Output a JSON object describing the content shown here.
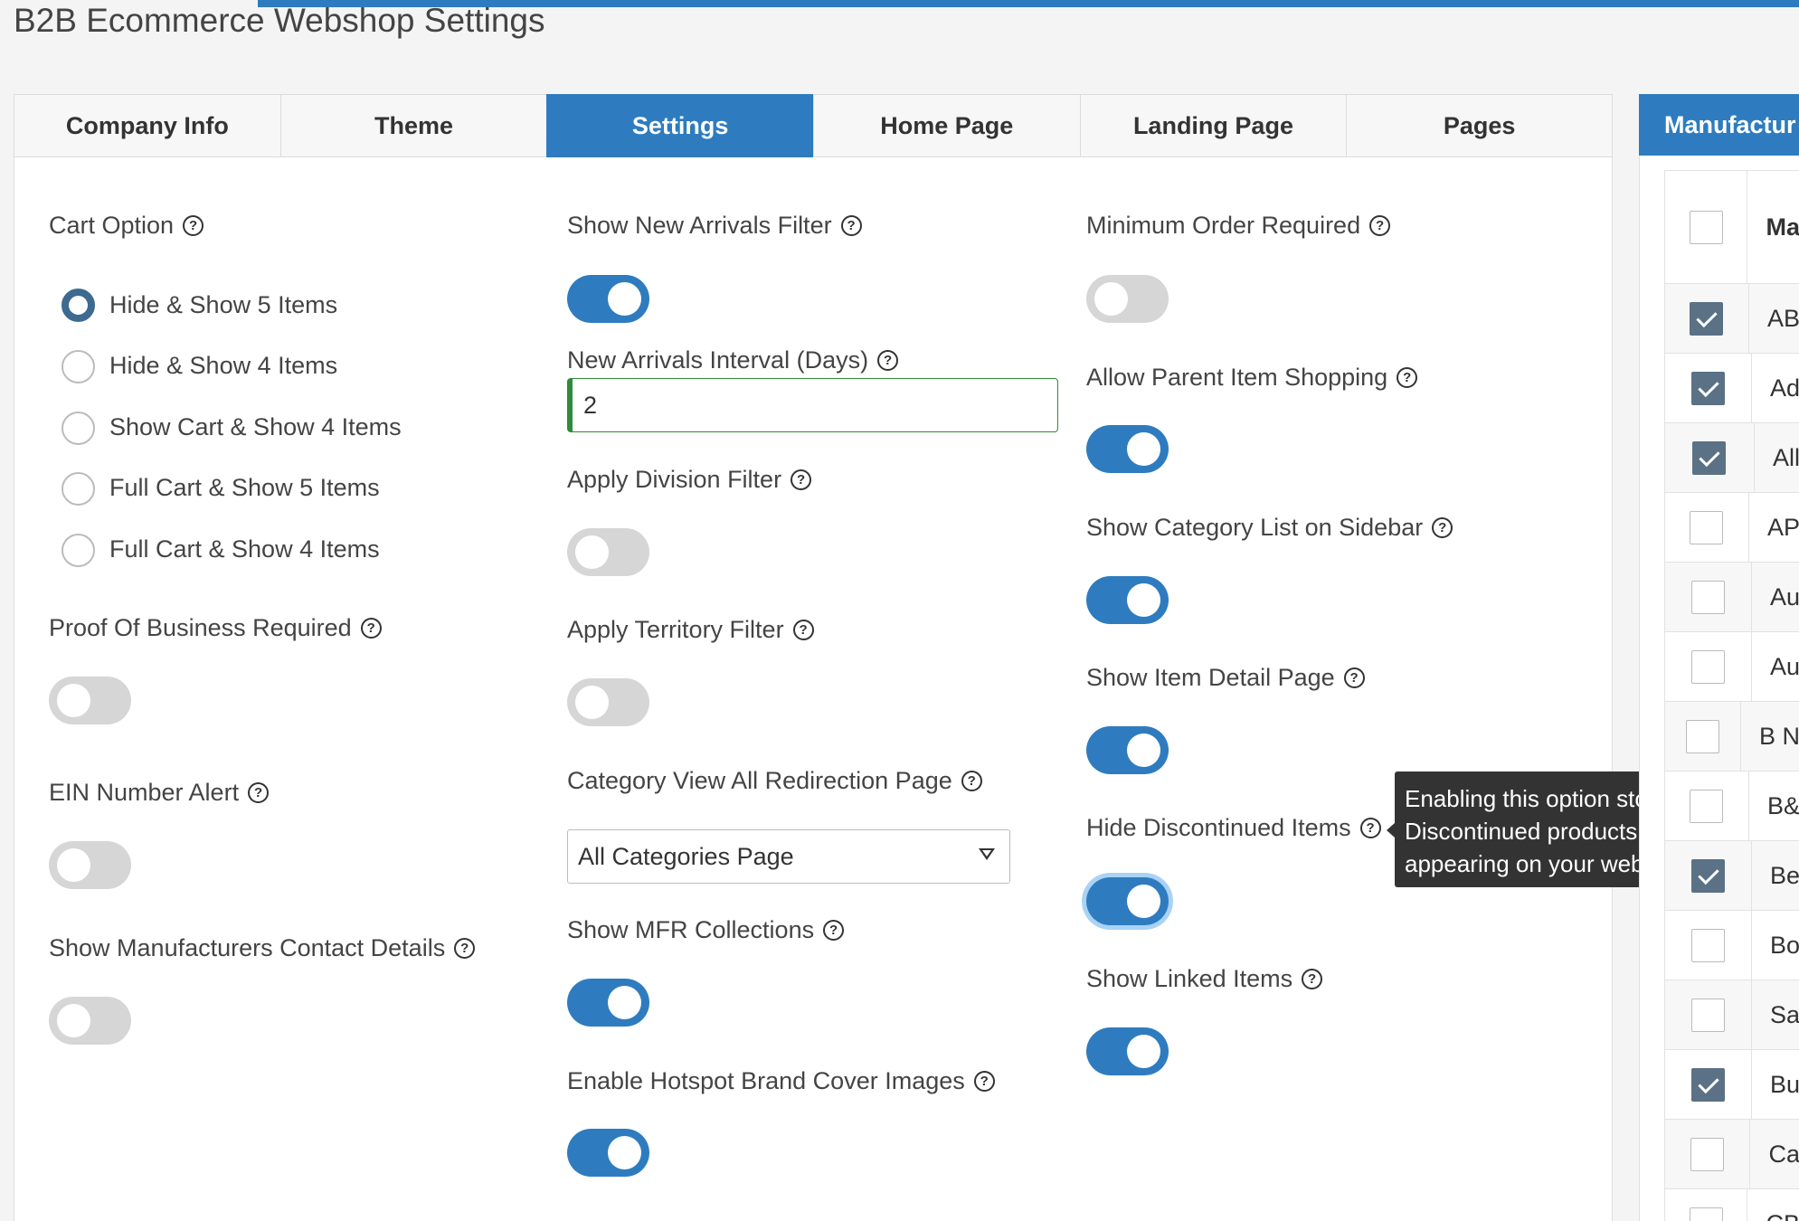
{
  "page": {
    "title": "B2B Ecommerce Webshop Settings"
  },
  "tabs": [
    "Company Info",
    "Theme",
    "Settings",
    "Home Page",
    "Landing Page",
    "Pages"
  ],
  "active_tab": "Settings",
  "column1": {
    "cart_option_label": "Cart Option",
    "cart_options": [
      {
        "label": "Hide & Show 5 Items",
        "checked": true
      },
      {
        "label": "Hide & Show 4 Items",
        "checked": false
      },
      {
        "label": "Show Cart & Show 4 Items",
        "checked": false
      },
      {
        "label": "Full Cart & Show 5 Items",
        "checked": false
      },
      {
        "label": "Full Cart & Show 4 Items",
        "checked": false
      }
    ],
    "proof_of_business_label": "Proof Of Business Required",
    "proof_of_business_on": false,
    "ein_alert_label": "EIN Number Alert",
    "ein_alert_on": false,
    "show_mfr_contact_label": "Show Manufacturers Contact Details",
    "show_mfr_contact_on": false
  },
  "column2": {
    "new_arrivals_filter_label": "Show New Arrivals Filter",
    "new_arrivals_filter_on": true,
    "new_arrivals_interval_label": "New Arrivals Interval (Days)",
    "new_arrivals_interval_value": "2",
    "division_filter_label": "Apply Division Filter",
    "division_filter_on": false,
    "territory_filter_label": "Apply Territory Filter",
    "territory_filter_on": false,
    "category_redirect_label": "Category View All Redirection Page",
    "category_redirect_value": "All Categories Page",
    "mfr_collections_label": "Show MFR Collections",
    "mfr_collections_on": true,
    "hotspot_label": "Enable Hotspot Brand Cover Images",
    "hotspot_on": true
  },
  "column3": {
    "min_order_label": "Minimum Order Required",
    "min_order_on": false,
    "parent_item_label": "Allow Parent Item Shopping",
    "parent_item_on": true,
    "category_sidebar_label": "Show Category List on Sidebar",
    "category_sidebar_on": true,
    "item_detail_label": "Show Item Detail Page",
    "item_detail_on": true,
    "hide_discontinued_label": "Hide Discontinued Items",
    "hide_discontinued_on": true,
    "linked_items_label": "Show Linked Items",
    "linked_items_on": true
  },
  "tooltip": {
    "line1": "Enabling this option stops",
    "line2": "Discontinued products from",
    "line3": "appearing on your website."
  },
  "manufacturers": {
    "tab_label": "Manufactur",
    "header": "Ma",
    "rows": [
      {
        "name": "AB",
        "checked": true
      },
      {
        "name": "Ad",
        "checked": true
      },
      {
        "name": "All",
        "checked": true
      },
      {
        "name": "AP",
        "checked": false
      },
      {
        "name": "Au",
        "checked": false
      },
      {
        "name": "Au",
        "checked": false
      },
      {
        "name": "B N",
        "checked": false
      },
      {
        "name": "B&",
        "checked": false
      },
      {
        "name": "Be",
        "checked": true
      },
      {
        "name": "Bo",
        "checked": false
      },
      {
        "name": "Sa",
        "checked": false
      },
      {
        "name": "Bu",
        "checked": true
      },
      {
        "name": "Ca",
        "checked": false
      },
      {
        "name": "CB",
        "checked": false
      }
    ]
  },
  "icons": {
    "help": "question-circle-icon",
    "dropdown": "caret-down-icon",
    "check": "checkmark-icon"
  },
  "colors": {
    "accent": "#2e7cbf",
    "radio_checked": "#3d6a8f",
    "checkbox_checked": "#5a7186",
    "input_valid": "#2e8b3a",
    "tooltip_bg": "#333333"
  }
}
